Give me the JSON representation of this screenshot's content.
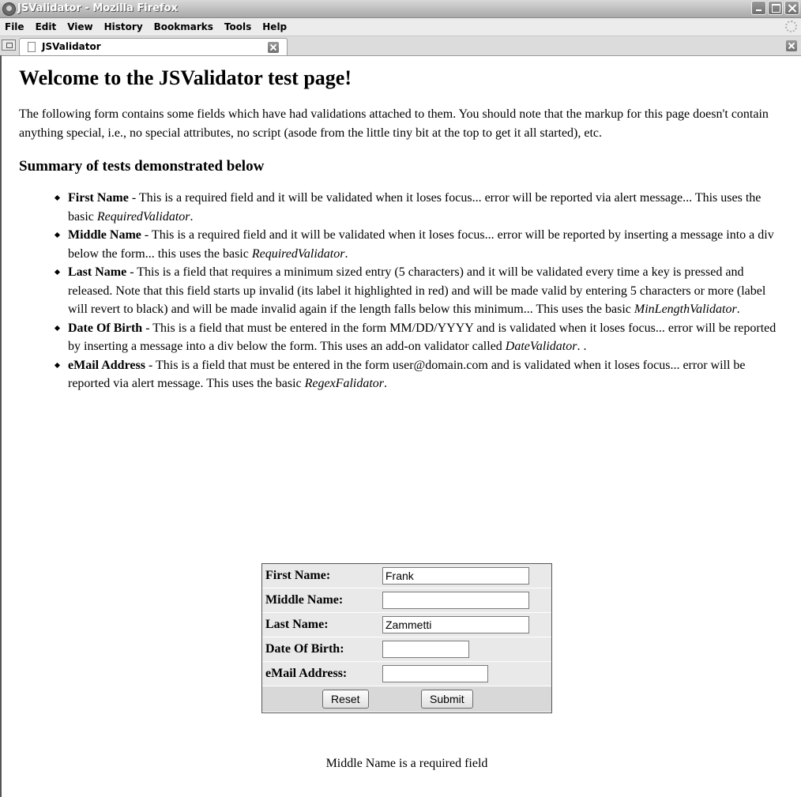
{
  "window": {
    "title": "JSValidator - Mozilla Firefox"
  },
  "menu": {
    "file": "File",
    "edit": "Edit",
    "view": "View",
    "history": "History",
    "bookmarks": "Bookmarks",
    "tools": "Tools",
    "help": "Help"
  },
  "tab": {
    "label": "JSValidator"
  },
  "page": {
    "heading": "Welcome to the JSValidator test page!",
    "intro": "The following form contains some fields which have had validations attached to them. You should note that the markup for this page doesn't contain anything special, i.e., no special attributes, no script (asode from the little tiny bit at the top to get it all started), etc.",
    "summary_heading": "Summary of tests demonstrated below",
    "tests": [
      {
        "name": "First Name",
        "text": " - This is a required field and it will be validated when it loses focus... error will be reported via alert message... This uses the basic ",
        "validator": "RequiredValidator",
        "tail": "."
      },
      {
        "name": "Middle Name",
        "text": " - This is a required field and it will be validated when it loses focus... error will be reported by inserting a message into a div below the form... this uses the basic ",
        "validator": "RequiredValidator",
        "tail": "."
      },
      {
        "name": "Last Name",
        "text": " - This is a field that requires a minimum sized entry (5 characters) and it will be validated every time a key is pressed and released. Note that this field starts up invalid (its label it highlighted in red) and will be made valid by entering 5 characters or more (label will revert to black) and will be made invalid again if the length falls below this minimum... This uses the basic ",
        "validator": "MinLengthValidator",
        "tail": "."
      },
      {
        "name": "Date Of Birth",
        "text": " - This is a field that must be entered in the form MM/DD/YYYY and is validated when it loses focus... error will be reported by inserting a message into a div below the form. This uses an add-on validator called ",
        "validator": "DateValidator",
        "tail": ". ."
      },
      {
        "name": "eMail Address",
        "text": " - This is a field that must be entered in the form user@domain.com and is validated when it loses focus... error will be reported via alert message. This uses the basic ",
        "validator": "RegexFalidator",
        "tail": "."
      }
    ]
  },
  "form": {
    "first_name_label": "First Name:",
    "first_name_value": "Frank",
    "middle_name_label": "Middle Name:",
    "middle_name_value": "",
    "last_name_label": "Last Name:",
    "last_name_value": "Zammetti",
    "dob_label": "Date Of Birth:",
    "dob_value": "",
    "email_label": "eMail Address:",
    "email_value": "",
    "reset_label": "Reset",
    "submit_label": "Submit"
  },
  "error_message": "Middle Name is a required field"
}
